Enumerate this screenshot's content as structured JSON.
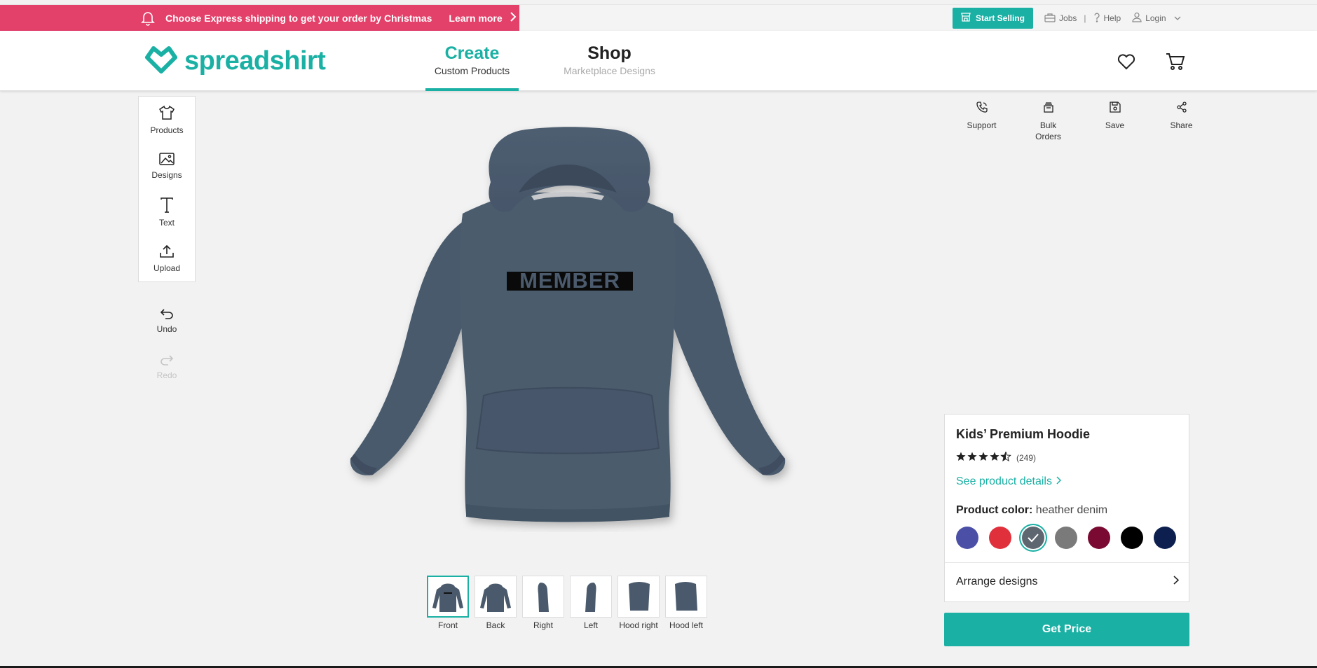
{
  "promo": {
    "text": "Choose Express shipping to get your order by Christmas",
    "link": "Learn more"
  },
  "topnav": {
    "start_selling": "Start Selling",
    "jobs": "Jobs",
    "separator": "|",
    "help": "Help",
    "login": "Login"
  },
  "brand": {
    "name": "spreadshirt"
  },
  "tabs": [
    {
      "title": "Create",
      "subtitle": "Custom Products"
    },
    {
      "title": "Shop",
      "subtitle": "Marketplace Designs"
    }
  ],
  "tools": [
    {
      "label": "Products",
      "icon": "tshirt-icon"
    },
    {
      "label": "Designs",
      "icon": "image-icon"
    },
    {
      "label": "Text",
      "icon": "text-icon"
    },
    {
      "label": "Upload",
      "icon": "upload-icon"
    }
  ],
  "history": {
    "undo": "Undo",
    "redo": "Redo"
  },
  "product_print": "MEMBER",
  "views": [
    {
      "label": "Front"
    },
    {
      "label": "Back"
    },
    {
      "label": "Right"
    },
    {
      "label": "Left"
    },
    {
      "label": "Hood right"
    },
    {
      "label": "Hood left"
    }
  ],
  "actions": [
    {
      "label": "Support",
      "icon": "phone-icon"
    },
    {
      "label": "Bulk Orders",
      "icon": "stack-icon"
    },
    {
      "label": "Save",
      "icon": "save-icon"
    },
    {
      "label": "Share",
      "icon": "share-icon"
    }
  ],
  "product": {
    "name": "Kids’ Premium Hoodie",
    "rating_count": "(249)",
    "rating": 4.5,
    "details_link": "See product details",
    "color_label": "Product color:",
    "color_value": "heather denim",
    "colors": [
      "#4b4fa6",
      "#e0303c",
      "#5e6670",
      "#7a7a7a",
      "#7a0a32",
      "#000000",
      "#0c1f4e"
    ],
    "selected_color_index": 2,
    "arrange": "Arrange designs",
    "cta": "Get Price"
  },
  "colors": {
    "accent": "#1ab0a4",
    "promo": "#e3406a",
    "hoodie": "#4a5a6c"
  }
}
